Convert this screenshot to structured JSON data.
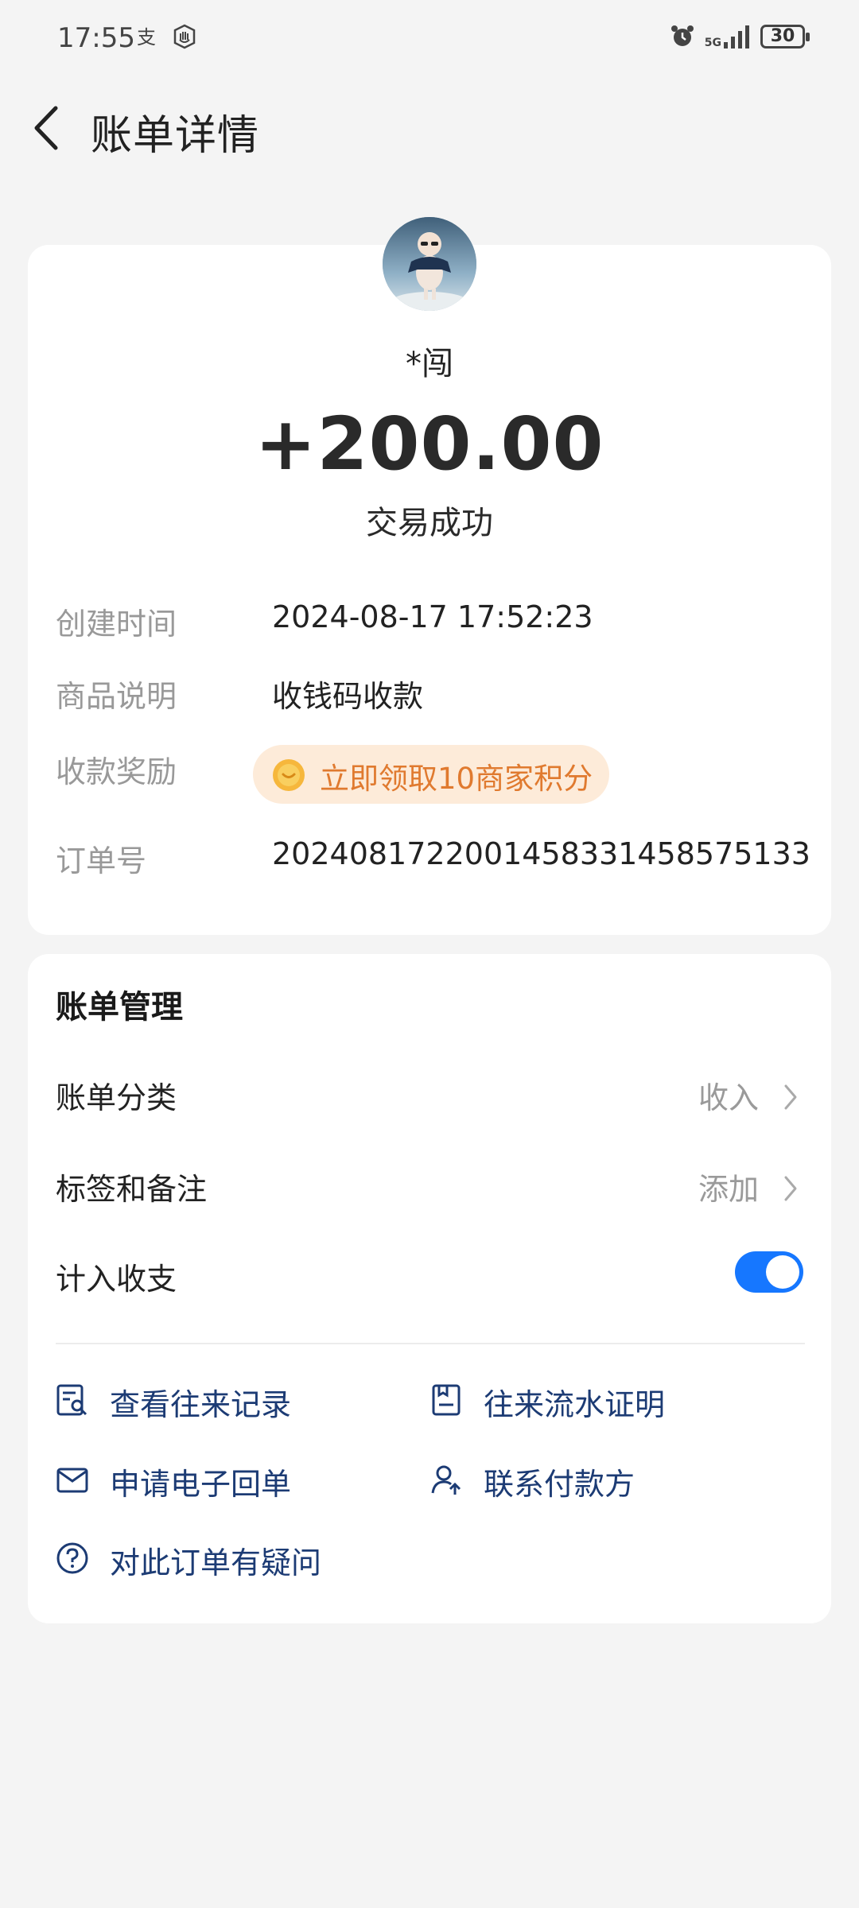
{
  "status_bar": {
    "time": "17:55",
    "network": "5G",
    "battery": "30"
  },
  "header": {
    "title": "账单详情"
  },
  "transaction": {
    "payer_name": "*闯",
    "amount": "+200.00",
    "status": "交易成功",
    "details": [
      {
        "label": "创建时间",
        "value": "2024-08-17 17:52:23"
      },
      {
        "label": "商品说明",
        "value": "收钱码收款"
      },
      {
        "label": "收款奖励",
        "value": "立即领取10商家积分"
      },
      {
        "label": "订单号",
        "value": "2024081722001458331458575133"
      }
    ]
  },
  "management": {
    "title": "账单管理",
    "category_label": "账单分类",
    "category_value": "收入",
    "tags_label": "标签和备注",
    "tags_value": "添加",
    "include_label": "计入收支",
    "include_on": true
  },
  "links": {
    "records": "查看往来记录",
    "proof": "往来流水证明",
    "receipt": "申请电子回单",
    "contact": "联系付款方",
    "question": "对此订单有疑问"
  },
  "colors": {
    "accent": "#1677ff",
    "link": "#1c3b74",
    "reward": "#e07a2f"
  }
}
